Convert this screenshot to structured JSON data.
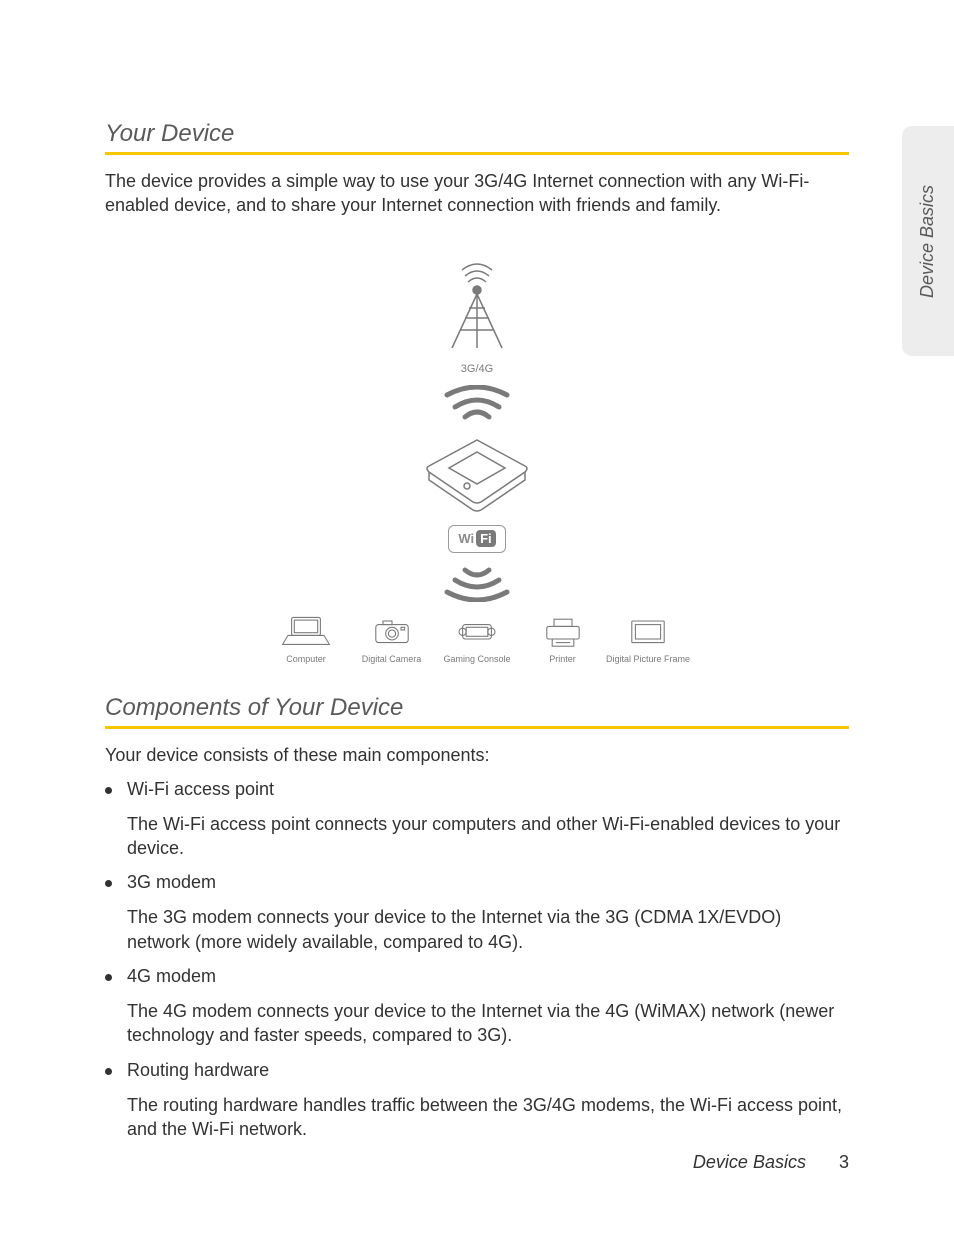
{
  "sideTab": "Device Basics",
  "section1": {
    "heading": "Your Device",
    "intro": "The device provides a simple way to use your 3G/4G Internet connection with any Wi-Fi-enabled device, and to share your Internet connection with friends and family."
  },
  "diagram": {
    "towerLabel": "3G/4G",
    "badgeWi": "Wi",
    "badgeFi": "Fi",
    "devices": [
      "Computer",
      "Digital Camera",
      "Gaming Console",
      "Printer",
      "Digital Picture Frame"
    ]
  },
  "section2": {
    "heading": "Components of Your Device",
    "intro": "Your device consists of these main components:",
    "items": [
      {
        "name": "Wi-Fi access point",
        "desc": "The Wi-Fi access point connects your computers and other Wi-Fi-enabled devices to your device."
      },
      {
        "name": "3G modem",
        "desc": "The 3G modem connects your device to the Internet via the 3G (CDMA 1X/EVDO) network (more widely available, compared to 4G)."
      },
      {
        "name": "4G modem",
        "desc": "The 4G modem connects your device to the Internet via the 4G (WiMAX) network (newer technology and faster speeds, compared to 3G)."
      },
      {
        "name": "Routing hardware",
        "desc": "The routing hardware handles traffic between the 3G/4G modems, the Wi-Fi access point, and the Wi-Fi network."
      }
    ]
  },
  "footer": {
    "section": "Device Basics",
    "page": "3"
  }
}
